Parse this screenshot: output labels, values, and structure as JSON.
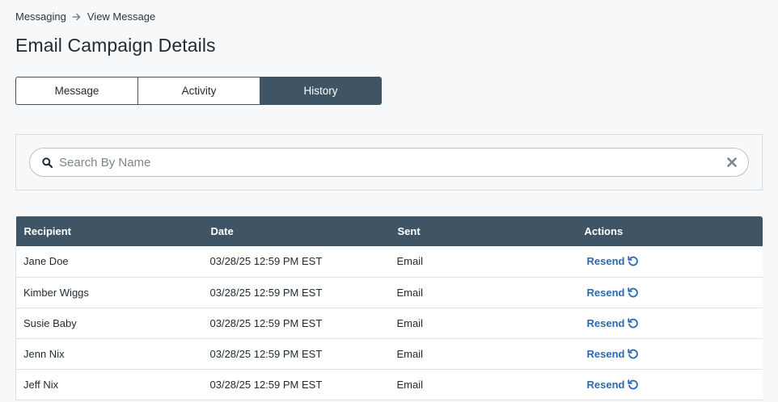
{
  "breadcrumb": {
    "items": [
      "Messaging",
      "View Message"
    ]
  },
  "page": {
    "title": "Email Campaign Details"
  },
  "tabs": [
    {
      "label": "Message",
      "active": false
    },
    {
      "label": "Activity",
      "active": false
    },
    {
      "label": "History",
      "active": true
    }
  ],
  "search": {
    "value": "",
    "placeholder": "Search By Name"
  },
  "table": {
    "headers": [
      "Recipient",
      "Date",
      "Sent",
      "Actions"
    ],
    "rows": [
      {
        "recipient": "Jane Doe",
        "date": "03/28/25 12:59 PM EST",
        "sent": "Email",
        "action": "Resend"
      },
      {
        "recipient": "Kimber Wiggs",
        "date": "03/28/25 12:59 PM EST",
        "sent": "Email",
        "action": "Resend"
      },
      {
        "recipient": "Susie Baby",
        "date": "03/28/25 12:59 PM EST",
        "sent": "Email",
        "action": "Resend"
      },
      {
        "recipient": "Jenn Nix",
        "date": "03/28/25 12:59 PM EST",
        "sent": "Email",
        "action": "Resend"
      },
      {
        "recipient": "Jeff Nix",
        "date": "03/28/25 12:59 PM EST",
        "sent": "Email",
        "action": "Resend"
      }
    ]
  },
  "icons": {
    "breadcrumb_separator": "arrow-right-icon",
    "search": "search-icon",
    "clear": "close-icon",
    "resend": "undo-icon"
  },
  "colors": {
    "header_bg": "#3f5565",
    "link": "#2a6ab1",
    "page_bg": "#f7f8fa"
  }
}
